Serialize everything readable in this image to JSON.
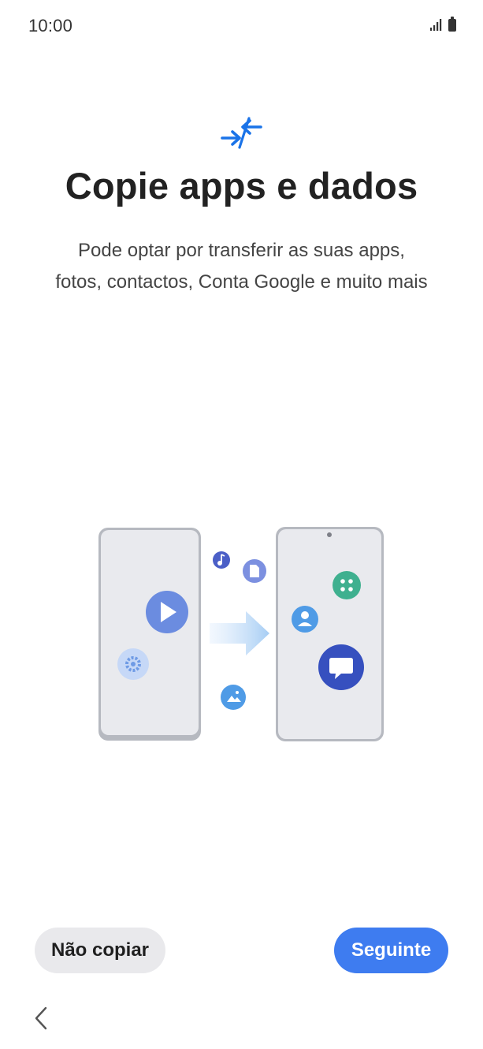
{
  "status_bar": {
    "time": "10:00",
    "signal_icon": "signal-icon",
    "battery_icon": "battery-icon"
  },
  "header": {
    "icon": "transfer-arrows-icon",
    "title": "Copie apps e dados",
    "description": "Pode optar por transferir as suas apps, fotos, contactos, Conta Google e muito mais"
  },
  "illustration": {
    "name": "phone-transfer-illustration",
    "icons": [
      "play-icon",
      "settings-icon",
      "music-icon",
      "file-icon",
      "image-icon",
      "apps-icon",
      "contact-icon",
      "message-icon"
    ]
  },
  "actions": {
    "skip_label": "Não copiar",
    "next_label": "Seguinte"
  },
  "navigation": {
    "back_icon": "back-chevron-icon"
  },
  "colors": {
    "primary": "#3e7cf0",
    "secondary_button": "#e9e9ec",
    "accent_icon": "#1a73e8"
  }
}
